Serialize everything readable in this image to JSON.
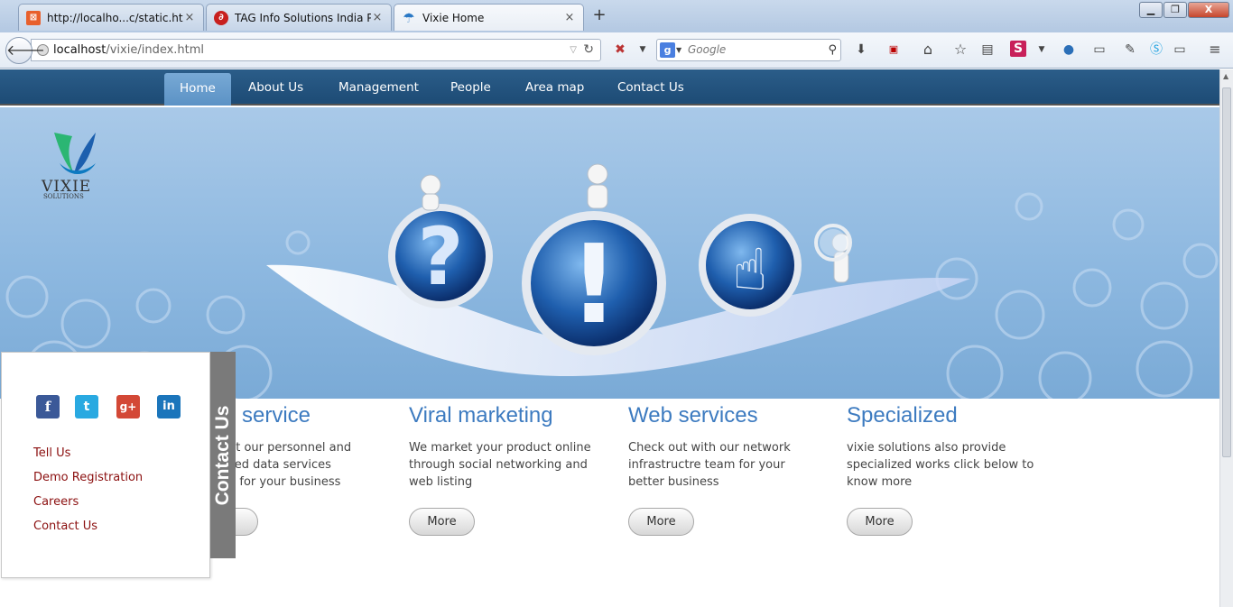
{
  "browser": {
    "tabs": [
      {
        "label": "http://localho...c/static.html",
        "favicon": "xampp-icon"
      },
      {
        "label": "TAG Info Solutions India P...",
        "favicon": "tag-logo-icon"
      },
      {
        "label": "Vixie Home",
        "favicon": "umbrella-icon"
      }
    ],
    "url_host": "localhost",
    "url_path": "/vixie/index.html",
    "search_engine": "Google",
    "search_placeholder": "Google"
  },
  "site": {
    "nav": [
      "Home",
      "About Us",
      "Management",
      "People",
      "Area map",
      "Contact Us"
    ],
    "active_nav": "Home",
    "logo_name": "VIXIE",
    "logo_sub": "SOLUTIONS",
    "features": [
      {
        "title": "service",
        "text": "ut our personnel and sed data services d for your business",
        "button": "e"
      },
      {
        "title": "Viral marketing",
        "text": "We market your product online through social networking and web listing",
        "button": "More"
      },
      {
        "title": "Web services",
        "text": "Check out with our network infrastructre team for your better business",
        "button": "More"
      },
      {
        "title": "Specialized",
        "text": "vixie solutions also provide specialized works click below to know more",
        "button": "More"
      }
    ],
    "contact_panel": {
      "tab_label": "Contact Us",
      "social": [
        "facebook-icon",
        "twitter-icon",
        "google-plus-icon",
        "linkedin-icon"
      ],
      "links": [
        "Tell Us",
        "Demo Registration",
        "Careers",
        "Contact Us"
      ]
    }
  },
  "colors": {
    "nav_bar": "#1d4b75",
    "nav_active": "#5b92c5",
    "heading_blue": "#3d7bc0",
    "panel_link": "#8b0f0f",
    "hero_bg": "#8db8e0"
  }
}
